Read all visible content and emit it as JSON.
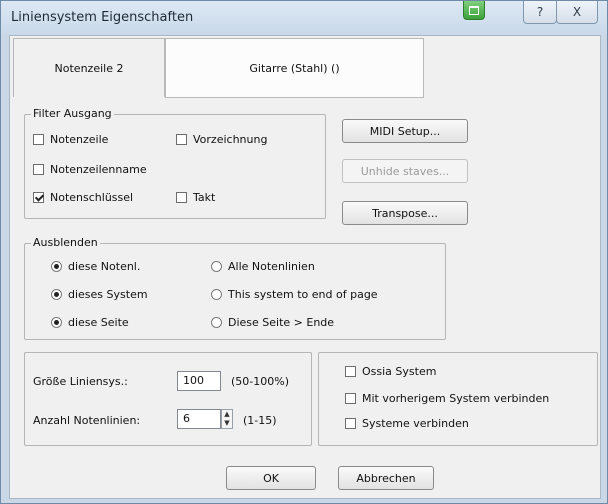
{
  "window": {
    "title": "Liniensystem Eigenschaften",
    "help_label": "?",
    "close_label": "X"
  },
  "tabs": [
    {
      "label": "Notenzeile 2"
    },
    {
      "label": "Gitarre (Stahl) ()"
    }
  ],
  "filter_group": {
    "legend": "Filter Ausgang",
    "options": [
      {
        "label": "Notenzeile",
        "checked": false
      },
      {
        "label": "Vorzeichnung",
        "checked": false
      },
      {
        "label": "Notenzeilenname",
        "checked": false
      },
      {
        "label": "Notenschlüssel",
        "checked": true
      },
      {
        "label": "Takt",
        "checked": false
      }
    ]
  },
  "side_buttons": {
    "midi_setup": "MIDI Setup...",
    "unhide_staves": "Unhide staves...",
    "transpose": "Transpose..."
  },
  "hide_group": {
    "legend": "Ausblenden",
    "options": [
      {
        "label": "diese Notenl.",
        "selected": true
      },
      {
        "label": "Alle Notenlinien",
        "selected": false
      },
      {
        "label": "dieses System",
        "selected": true
      },
      {
        "label": "This system to end of page",
        "selected": false
      },
      {
        "label": "diese Seite",
        "selected": true
      },
      {
        "label": "Diese Seite > Ende",
        "selected": false
      }
    ]
  },
  "size_group": {
    "size_label": "Größe Liniensys.:",
    "size_value": "100",
    "size_range": "(50-100%)",
    "lines_label": "Anzahl Notenlinien:",
    "lines_value": "6",
    "lines_range": "(1-15)"
  },
  "system_group": {
    "options": [
      {
        "label": "Ossia System",
        "checked": false
      },
      {
        "label": "Mit vorherigem System verbinden",
        "checked": false
      },
      {
        "label": "Systeme verbinden",
        "checked": false
      }
    ]
  },
  "footer": {
    "ok_label": "OK",
    "cancel_label": "Abbrechen"
  }
}
